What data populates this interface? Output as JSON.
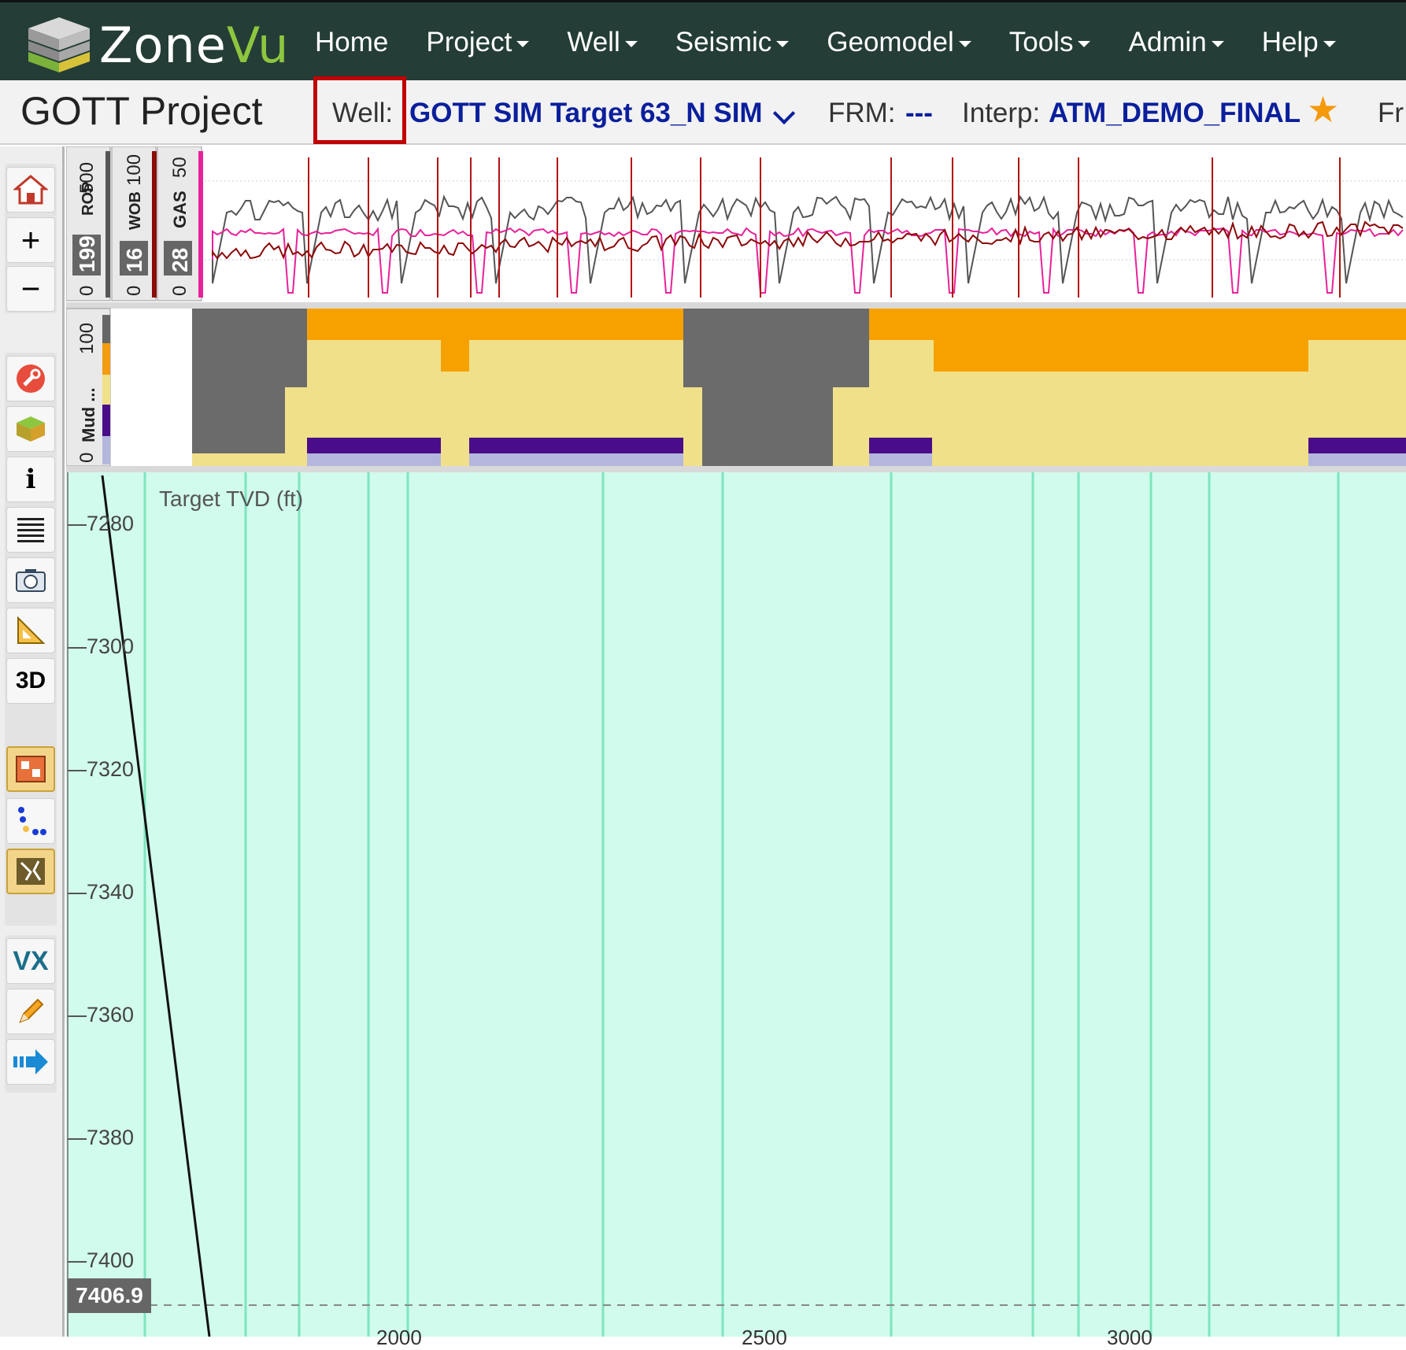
{
  "app": {
    "logo_text_a": "Zone",
    "logo_text_b": "Vu",
    "nav": [
      {
        "label": "Home",
        "dropdown": false
      },
      {
        "label": "Project",
        "dropdown": true
      },
      {
        "label": "Well",
        "dropdown": true
      },
      {
        "label": "Seismic",
        "dropdown": true
      },
      {
        "label": "Geomodel",
        "dropdown": true
      },
      {
        "label": "Tools",
        "dropdown": true
      },
      {
        "label": "Admin",
        "dropdown": true
      },
      {
        "label": "Help",
        "dropdown": true
      }
    ]
  },
  "subbar": {
    "project_title": "GOTT Project",
    "well_label": "Well:",
    "well_name": "GOTT SIM Target 63_N SIM",
    "frm_label": "FRM:",
    "frm_value": "---",
    "interp_label": "Interp:",
    "interp_value": "ATM_DEMO_FINAL",
    "cut_label": "Fr"
  },
  "toolbar": {
    "buttons": [
      "home-icon",
      "zoom-in-icon",
      "zoom-out-icon",
      "wrench-icon",
      "layers-icon",
      "info-icon",
      "list-icon",
      "camera-icon",
      "ruler-icon",
      "3d-icon",
      "panel-toggle-icon",
      "points-icon",
      "fault-icon",
      "vx-icon",
      "pencil-icon",
      "arrow-right-icon"
    ],
    "label_3d": "3D",
    "label_vx": "VX",
    "label_info": "i"
  },
  "log_tracks": {
    "track1": {
      "name": "ROP",
      "min": "0",
      "max": "500",
      "value": "199",
      "color": "#555555"
    },
    "track2": {
      "name": "WOB",
      "min": "0",
      "max": "100",
      "value": "16",
      "color": "#8b0a0a"
    },
    "track3": {
      "name": "GAS",
      "min": "0",
      "max": "50",
      "value": "28",
      "color": "#e8229a"
    },
    "lith": {
      "name": "Mud ...",
      "min": "0",
      "max": "100"
    }
  },
  "section": {
    "axis_title": "Target TVD (ft)",
    "depth_ticks": [
      "7280",
      "7300",
      "7320",
      "7340",
      "7360",
      "7380",
      "7400"
    ],
    "current_depth": "7406.9",
    "bottom_ticks": [
      "2000",
      "2500",
      "3000"
    ],
    "bg_color": "#d1fbec",
    "grid_color": "#7de6bf"
  }
}
